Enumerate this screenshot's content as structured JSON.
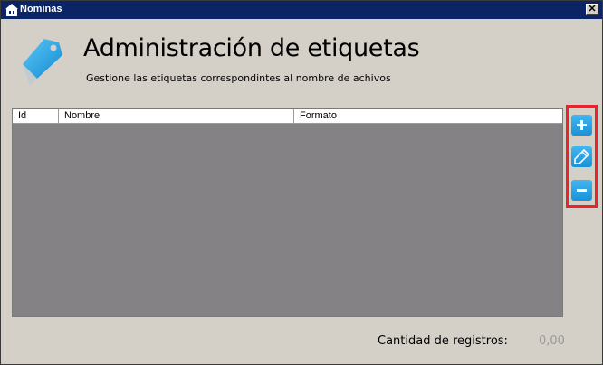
{
  "window": {
    "title": "Nominas",
    "close_label": "✕"
  },
  "header": {
    "title": "Administración de etiquetas",
    "subtitle": "Gestione las etiquetas correspondintes al nombre de achivos",
    "icon": "tag-icon"
  },
  "grid": {
    "columns": [
      "Id",
      "Nombre",
      "Formato"
    ],
    "rows": []
  },
  "toolbar": {
    "buttons": [
      {
        "name": "add",
        "icon": "plus-icon"
      },
      {
        "name": "edit",
        "icon": "pencil-icon"
      },
      {
        "name": "remove",
        "icon": "minus-icon"
      }
    ],
    "highlight_color": "#e8242c",
    "button_color": "#2aa3e6"
  },
  "footer": {
    "count_label": "Cantidad de registros:",
    "count_value": "0,00"
  }
}
